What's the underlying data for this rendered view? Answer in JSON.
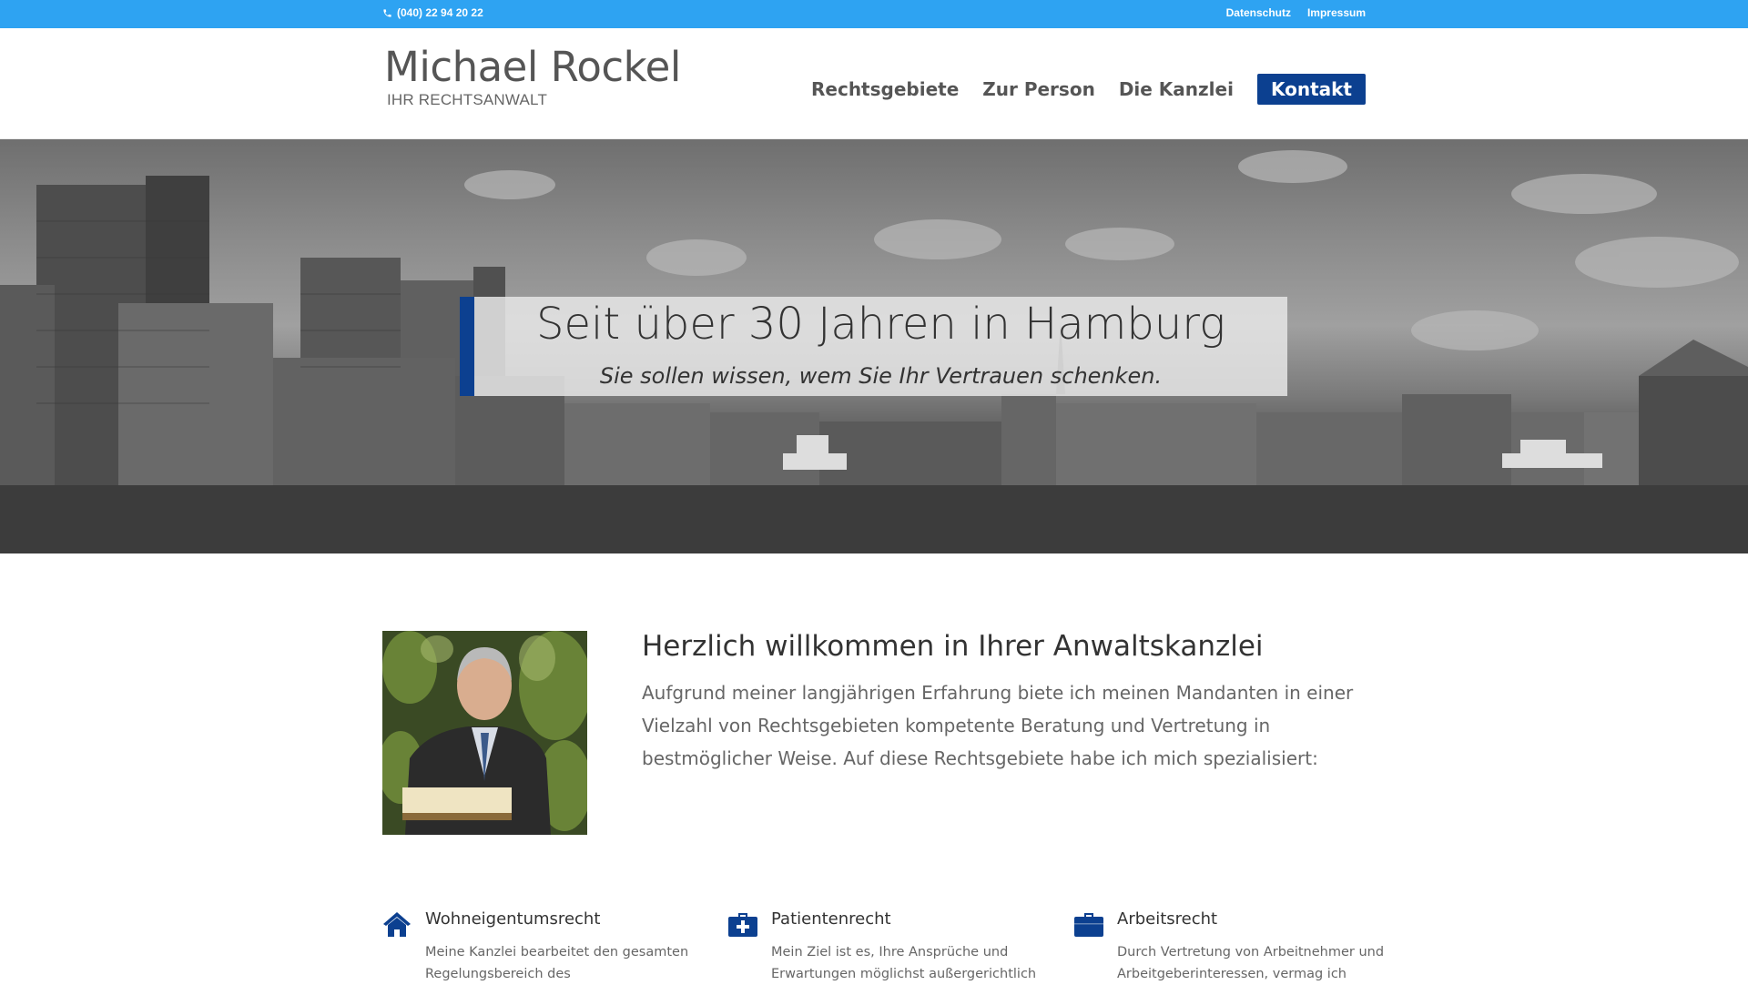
{
  "topbar": {
    "phone": "(040) 22 94 20 22",
    "links": [
      "Datenschutz",
      "Impressum"
    ]
  },
  "header": {
    "logo_name": "Michael Rockel",
    "logo_sub": "IHR RECHTSANWALT",
    "nav": [
      "Rechtsgebiete",
      "Zur Person",
      "Die Kanzlei"
    ],
    "cta": "Kontakt"
  },
  "hero": {
    "title": "Seit über 30 Jahren in Hamburg",
    "subtitle": "Sie sollen wissen, wem Sie Ihr Vertrauen schenken."
  },
  "welcome": {
    "title": "Herzlich willkommen in Ihrer Anwaltskanzlei",
    "text": "Aufgrund meiner langjährigen Erfahrung biete ich meinen Mandanten in einer Vielzahl von Rechtsgebieten kompetente Beratung und Vertretung in bestmöglicher Weise. Auf diese Rechtsgebiete habe ich mich spezialisiert:"
  },
  "features": [
    {
      "icon": "home-icon",
      "title": "Wohneigentumsrecht",
      "text": "Meine Kanzlei bearbeitet den gesamten Regelungsbereich des"
    },
    {
      "icon": "medical-kit-icon",
      "title": "Patientenrecht",
      "text": "Mein Ziel ist es, Ihre Ansprüche und Erwartungen möglichst außergerichtlich"
    },
    {
      "icon": "briefcase-icon",
      "title": "Arbeitsrecht",
      "text": "Durch Vertretung von Arbeitnehmer und Arbeitgeberinteressen, vermag ich"
    }
  ],
  "colors": {
    "topbar": "#2ea3f2",
    "accent": "#0c4090"
  }
}
